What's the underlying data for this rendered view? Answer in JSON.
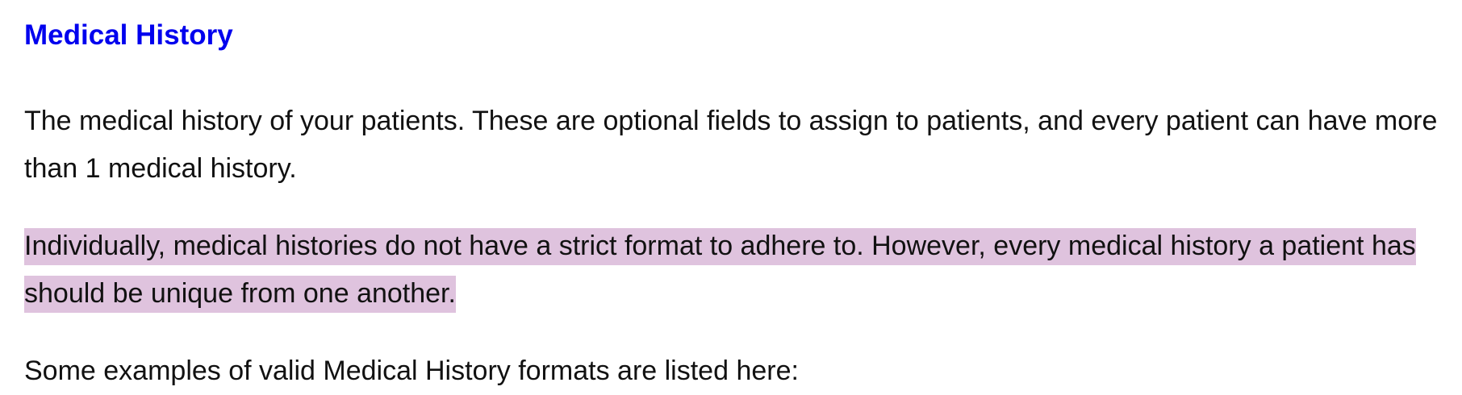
{
  "heading": {
    "text": "Medical History",
    "color": "#0000ee"
  },
  "paragraphs": [
    "The medical history of your patients. These are optional fields to assign to patients, and every patient can have more than 1 medical history.",
    "Individually, medical histories do not have a strict format to adhere to. However, every medical history a patient has should be unique from one another.",
    "Some examples of valid Medical History formats are listed here:"
  ],
  "highlight_color": "#dfc3de"
}
